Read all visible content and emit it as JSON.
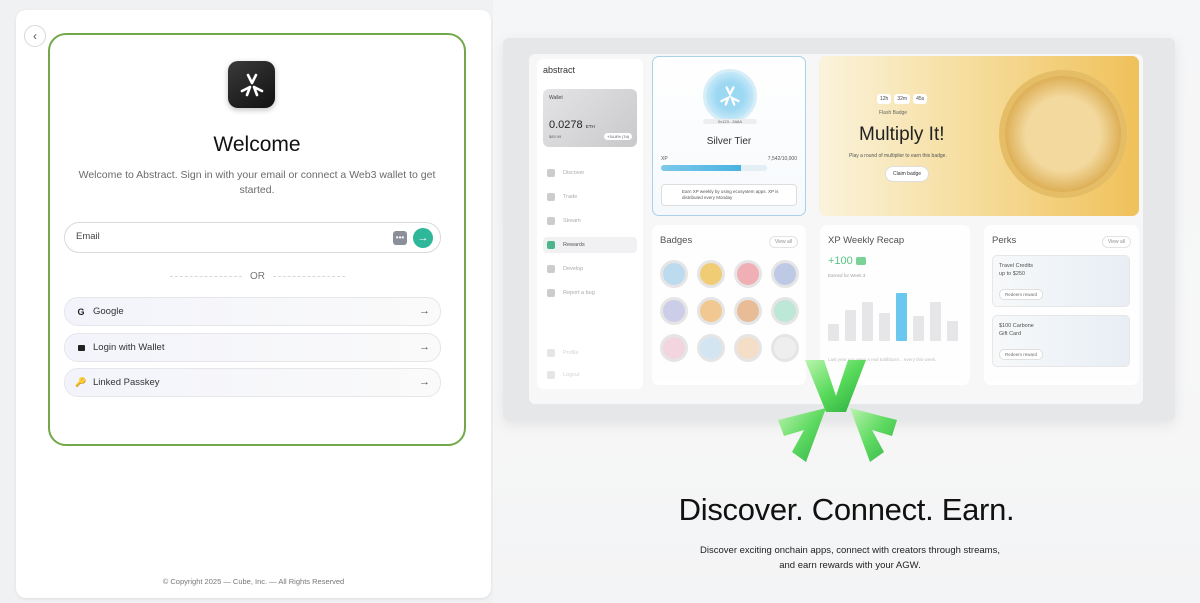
{
  "login": {
    "title": "Welcome",
    "subtitle": "Welcome to Abstract. Sign in with your email or connect a Web3 wallet to get started.",
    "email_placeholder": "Email",
    "or_label": "OR",
    "options": [
      {
        "label": "Google",
        "icon": "google-icon"
      },
      {
        "label": "Login with Wallet",
        "icon": "wallet-icon"
      },
      {
        "label": "Linked Passkey",
        "icon": "key-icon"
      }
    ],
    "accent_border": "#72a84a",
    "submit_color": "#2fb79a"
  },
  "footer": {
    "copyright": "© Copyright 2025 — Cube, Inc. — All Rights Reserved"
  },
  "preview": {
    "brand": "abstract",
    "wallet": {
      "label": "Wallet",
      "amount": "0.0278",
      "unit": "ETH",
      "usd": "$85.99",
      "change": "+34.8% (7d)"
    },
    "nav": [
      "Discover",
      "Trade",
      "Stream",
      "Rewards",
      "Develop",
      "Report a bug"
    ],
    "nav_bottom": [
      "Profile",
      "Logout"
    ],
    "active_nav": "Rewards",
    "tier": {
      "address": "0x123...3A6A",
      "name": "Silver Tier",
      "xp_label": "XP",
      "xp_value": "7,542/10,000",
      "xp_progress": 0.7542,
      "note": "Earn XP weekly by using ecosystem apps. XP is distributed every Monday"
    },
    "promo": {
      "timer": [
        "12h",
        "32m",
        "45s"
      ],
      "badge_label": "Flash Badge",
      "title": "Multiply It!",
      "subtitle": "Play a round of multiplier to earn this badge.",
      "button": "Claim badge"
    },
    "badges": {
      "title": "Badges",
      "view_all": "View all"
    },
    "recap": {
      "title": "XP Weekly Recap",
      "value": "+100",
      "sub": "Earned for Week 3",
      "footer": "Last year you were a real trailblazer... every this week.",
      "bars": [
        0.3,
        0.55,
        0.7,
        0.5,
        0.85,
        0.45,
        0.7,
        0.35
      ],
      "highlight_index": 4
    },
    "perks": {
      "title": "Perks",
      "view_all": "View all",
      "items": [
        {
          "title": "Travel Credits",
          "subtitle": "up to $250",
          "button": "Redeem reward"
        },
        {
          "title": "$100 Carbone",
          "subtitle": "Gift Card",
          "button": "Redeem reward"
        }
      ]
    }
  },
  "hero": {
    "title": "Discover. Connect. Earn.",
    "subtitle": "Discover exciting onchain apps, connect with creators through streams, and earn rewards with your AGW."
  }
}
